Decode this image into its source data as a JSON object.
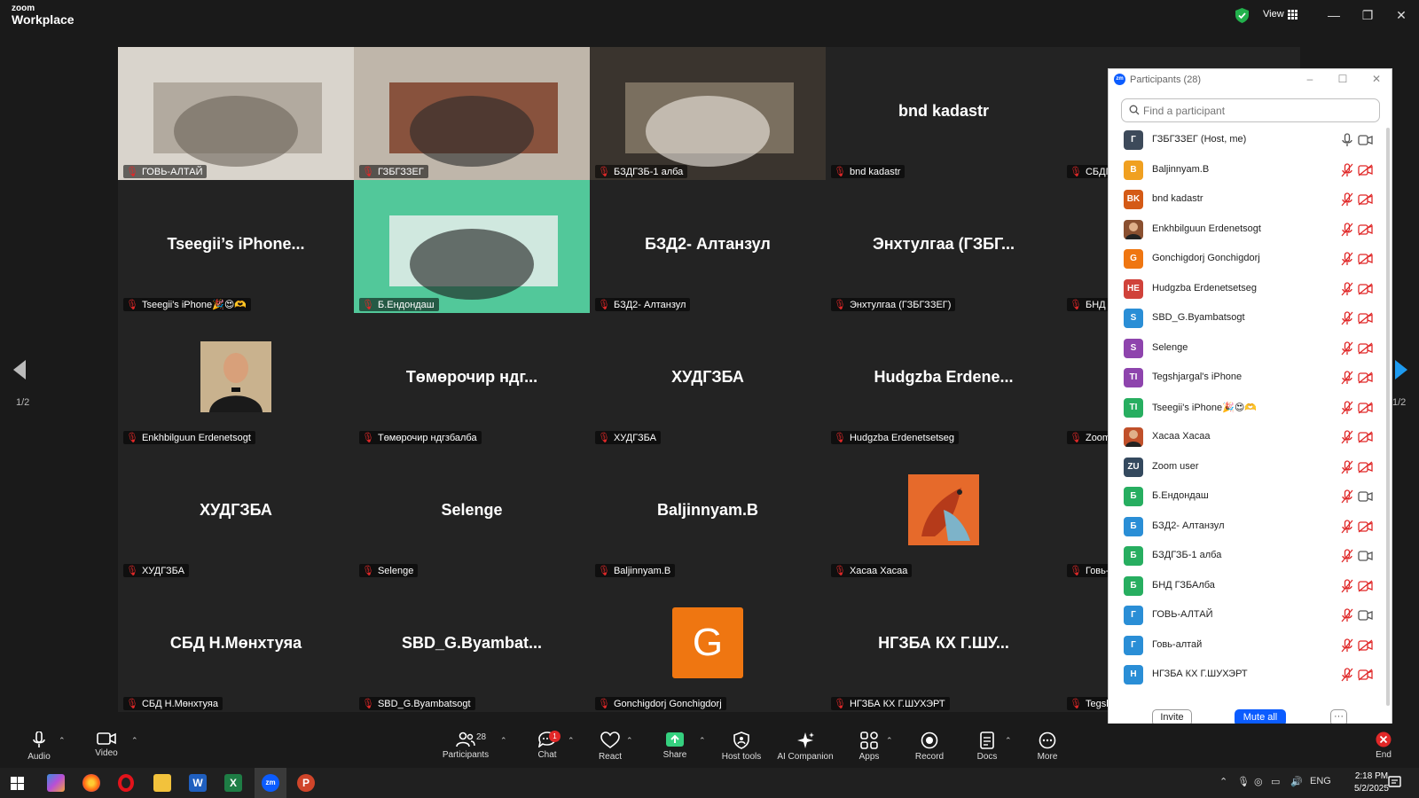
{
  "app": {
    "brand_small": "zoom",
    "brand_large": "Workplace",
    "view_label": "View"
  },
  "gallery": {
    "page_indicator": "1/2",
    "tiles": [
      {
        "big": "",
        "name": "ГОВЬ-АЛТАЙ",
        "type": "video"
      },
      {
        "big": "",
        "name": "ГЗБГЗЗЕГ",
        "type": "video",
        "active": true
      },
      {
        "big": "",
        "name": "БЗДГЗБ-1 алба",
        "type": "video"
      },
      {
        "big": "bnd kadastr",
        "name": "bnd kadastr",
        "type": "text"
      },
      {
        "big": "",
        "name": "СБДГЗ",
        "type": "text"
      },
      {
        "big": "Tseegii’s iPhone...",
        "name": "Tseegii's iPhone🎉😍🫶",
        "type": "text"
      },
      {
        "big": "",
        "name": "Б.Ендондаш",
        "type": "video"
      },
      {
        "big": "БЗД2- Алтанзул",
        "name": "БЗД2- Алтанзул",
        "type": "text"
      },
      {
        "big": "Энхтулгаа (ГЗБГ...",
        "name": "Энхтулгаа (ГЗБГЗЗЕГ)",
        "type": "text"
      },
      {
        "big": "",
        "name": "БНД Г",
        "type": "text"
      },
      {
        "big": "",
        "name": "Enkhbilguun Erdenetsogt",
        "type": "photo"
      },
      {
        "big": "Төмөрочир ндг...",
        "name": "Төмөрочир ндгзбалба",
        "type": "text"
      },
      {
        "big": "ХУДГЗБА",
        "name": "ХУДГЗБА",
        "type": "text"
      },
      {
        "big": "Hudgzba Erdene...",
        "name": "Hudgzba Erdenetsetseg",
        "type": "text"
      },
      {
        "big": "",
        "name": "Zoom",
        "type": "text"
      },
      {
        "big": "ХУДГЗБА",
        "name": "ХУДГЗБА",
        "type": "text"
      },
      {
        "big": "Selenge",
        "name": "Selenge",
        "type": "text"
      },
      {
        "big": "Baljinnyam.B",
        "name": "Baljinnyam.B",
        "type": "text"
      },
      {
        "big": "",
        "name": "Хасаа Хасаа",
        "type": "dragon"
      },
      {
        "big": "",
        "name": "Говь-",
        "type": "text"
      },
      {
        "big": "СБД Н.Мөнхтуяа",
        "name": "СБД Н.Мөнхтуяа",
        "type": "text"
      },
      {
        "big": "SBD_G.Byambat...",
        "name": "SBD_G.Byambatsogt",
        "type": "text"
      },
      {
        "big": "G",
        "name": "Gonchigdorj Gonchigdorj",
        "type": "letter"
      },
      {
        "big": "НГЗБА КХ Г.ШУ...",
        "name": "НГЗБА КХ Г.ШУХЭРТ",
        "type": "text"
      },
      {
        "big": "",
        "name": "Tegsh",
        "type": "text"
      }
    ]
  },
  "participants": {
    "title": "Participants (28)",
    "search_placeholder": "Find a participant",
    "items": [
      {
        "initials": "Г",
        "color": "#3d4a5a",
        "name": "ГЗБГЗЗЕГ (Host, me)",
        "mic": "on",
        "cam": "on"
      },
      {
        "initials": "B",
        "color": "#f0a020",
        "name": "Baljinnyam.B",
        "mic": "off",
        "cam": "off"
      },
      {
        "initials": "BK",
        "color": "#d45a16",
        "name": "bnd kadastr",
        "mic": "off",
        "cam": "off"
      },
      {
        "initials": "",
        "color": "#8a5030",
        "name": "Enkhbilguun Erdenetsogt",
        "mic": "off",
        "cam": "off",
        "photo": true
      },
      {
        "initials": "G",
        "color": "#ef7611",
        "name": "Gonchigdorj Gonchigdorj",
        "mic": "off",
        "cam": "off"
      },
      {
        "initials": "HE",
        "color": "#d0423a",
        "name": "Hudgzba Erdenetsetseg",
        "mic": "off",
        "cam": "off"
      },
      {
        "initials": "S",
        "color": "#2a8ed6",
        "name": "SBD_G.Byambatsogt",
        "mic": "off",
        "cam": "off"
      },
      {
        "initials": "S",
        "color": "#8e44ad",
        "name": "Selenge",
        "mic": "off",
        "cam": "off"
      },
      {
        "initials": "TI",
        "color": "#8e44ad",
        "name": "Tegshjargal's iPhone",
        "mic": "off",
        "cam": "off"
      },
      {
        "initials": "TI",
        "color": "#27ae60",
        "name": "Tseegii's iPhone🎉😍🫶",
        "mic": "off",
        "cam": "off"
      },
      {
        "initials": "",
        "color": "#c0502a",
        "name": "Хасаа Хасаа",
        "mic": "off",
        "cam": "off",
        "photo": true
      },
      {
        "initials": "ZU",
        "color": "#34495e",
        "name": "Zoom user",
        "mic": "off",
        "cam": "off"
      },
      {
        "initials": "Б",
        "color": "#27ae60",
        "name": "Б.Ендондаш",
        "mic": "off",
        "cam": "on"
      },
      {
        "initials": "Б",
        "color": "#2a8ed6",
        "name": "БЗД2- Алтанзул",
        "mic": "off",
        "cam": "off"
      },
      {
        "initials": "Б",
        "color": "#27ae60",
        "name": "БЗДГЗБ-1 алба",
        "mic": "off",
        "cam": "on"
      },
      {
        "initials": "Б",
        "color": "#27ae60",
        "name": "БНД ГЗБАлба",
        "mic": "off",
        "cam": "off"
      },
      {
        "initials": "Г",
        "color": "#2a8ed6",
        "name": "ГОВЬ-АЛТАЙ",
        "mic": "off",
        "cam": "on"
      },
      {
        "initials": "Г",
        "color": "#2a8ed6",
        "name": "Говь-алтай",
        "mic": "off",
        "cam": "off"
      },
      {
        "initials": "Н",
        "color": "#2a8ed6",
        "name": "НГЗБА КХ Г.ШУХЭРТ",
        "mic": "off",
        "cam": "off"
      }
    ],
    "invite_label": "Invite",
    "mute_all_label": "Mute all",
    "more_label": "···"
  },
  "toolbar": {
    "audio": "Audio",
    "video": "Video",
    "participants": "Participants",
    "participants_count": "28",
    "chat": "Chat",
    "chat_badge": "1",
    "react": "React",
    "share": "Share",
    "host_tools": "Host tools",
    "ai_companion": "AI Companion",
    "apps": "Apps",
    "record": "Record",
    "docs": "Docs",
    "more": "More",
    "end": "End"
  },
  "taskbar": {
    "language": "ENG",
    "time": "2:18 PM",
    "date": "5/2/2025"
  },
  "colors": {
    "accent": "#0b5cff",
    "mute_red": "#e02828",
    "active_border": "#35d07f",
    "share_green": "#35d07f"
  }
}
